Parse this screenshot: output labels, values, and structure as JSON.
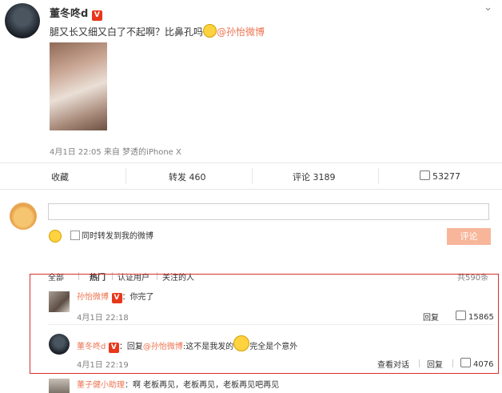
{
  "post": {
    "author": "董冬咚d",
    "verified_badge": "V",
    "text_before": "腿又长又细又白了不起啊？比鼻孔吗",
    "mention": "@孙怡微博",
    "meta": "4月1日 22:05 来自 梦透的iPhone X"
  },
  "actions": {
    "collect": "收藏",
    "repost": "转发 460",
    "comment": "评论 3189",
    "like": "53277"
  },
  "composer": {
    "checkbox_label": "同时转发到我的微博",
    "submit_label": "评论"
  },
  "filters": {
    "all": "全部",
    "hot": "热门",
    "verified": "认证用户",
    "following": "关注的人",
    "total": "共590条"
  },
  "comments": [
    {
      "name": "孙怡微博",
      "badge": "V",
      "text": "：你完了",
      "time": "4月1日 22:18",
      "reply": "回复",
      "likes": "15865"
    },
    {
      "name": "董冬咚d",
      "badge": "V",
      "text_pre": "：回复",
      "mention": "@孙怡微博",
      "text_mid": ":这不是我发的",
      "text_post": "完全是个意外",
      "time": "4月1日 22:19",
      "view_conversation": "查看对话",
      "reply": "回复",
      "likes": "4076"
    },
    {
      "name": "董子健小助理",
      "text": "：啊 老板再见，老板再见，老板再见吧再见"
    }
  ],
  "colors": {
    "accent": "#eb7350",
    "highlight_box": "#d6302c",
    "submit_bg": "#f7b69a"
  }
}
